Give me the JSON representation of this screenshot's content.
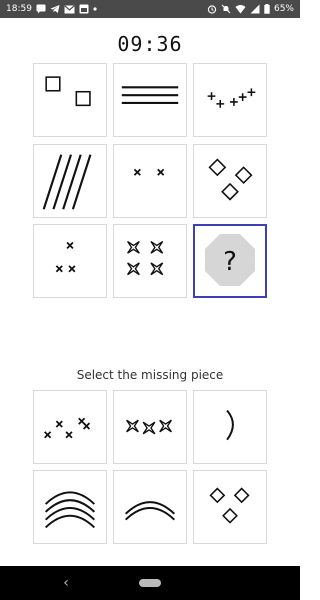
{
  "status_bar": {
    "time": "18:59",
    "left_icons": [
      "sms-icon",
      "telegram-icon",
      "gmail-icon",
      "calendar-icon",
      "dot-icon"
    ],
    "right_icons": [
      "alarm-icon",
      "mute-icon",
      "wifi-icon",
      "signal-icon",
      "battery-icon"
    ],
    "battery": "65%"
  },
  "timer": "09:36",
  "puzzle": {
    "grid": [
      "two-squares",
      "three-lines",
      "five-pluses",
      "four-diagonal-lines",
      "two-crosses",
      "three-diamonds",
      "three-crosses",
      "four-stars",
      "missing-piece"
    ],
    "missing_label": "?"
  },
  "prompt": "Select the missing piece",
  "answers": [
    "five-crosses",
    "three-stars",
    "one-arc",
    "four-arcs",
    "two-arcs",
    "three-diamonds"
  ],
  "colors": {
    "selected_border": "#3f3fb5",
    "missing_fill": "#d6d6d6",
    "tile_border": "#d9d9d9"
  }
}
